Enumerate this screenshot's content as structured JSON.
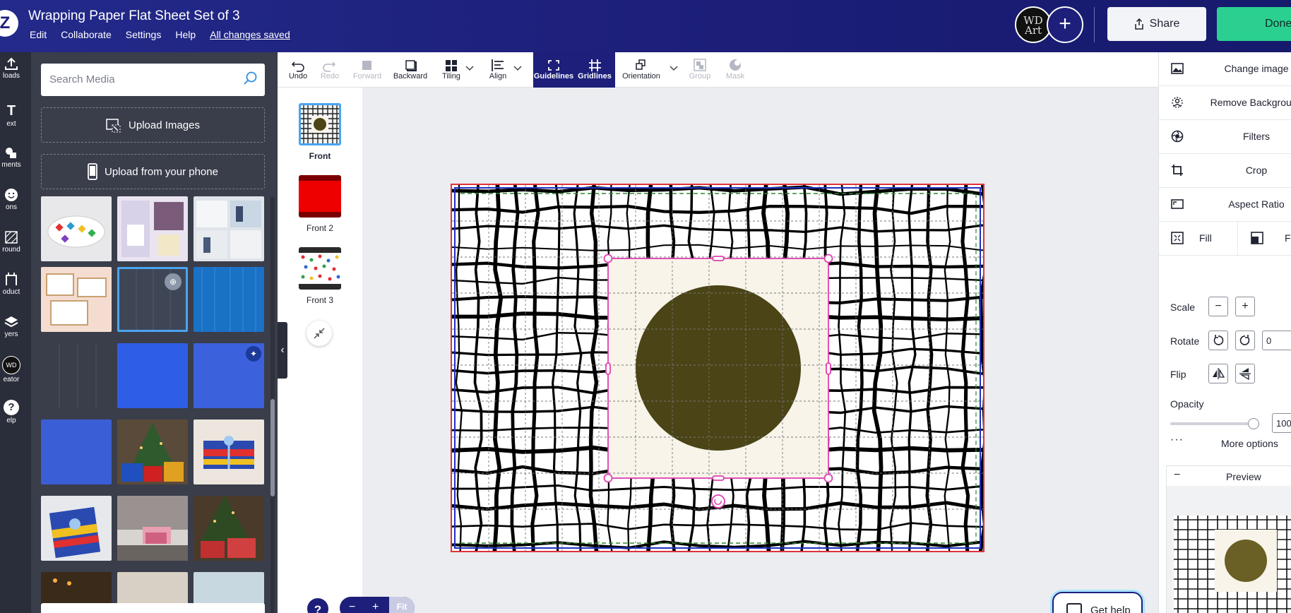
{
  "app": {
    "doc_title": "Wrapping Paper Flat Sheet Set of 3",
    "menu": [
      "Edit",
      "Collaborate",
      "Settings",
      "Help"
    ],
    "save_status": "All changes saved",
    "avatar_initials": "WD Art",
    "share_label": "Share",
    "done_label": "Done"
  },
  "rail": [
    {
      "label": "loads",
      "icon": "upload-icon"
    },
    {
      "label": "ext",
      "icon": "text-icon"
    },
    {
      "label": "ments",
      "icon": "elements-icon"
    },
    {
      "label": "ons",
      "icon": "icons-icon"
    },
    {
      "label": "round",
      "icon": "background-icon"
    },
    {
      "label": "oduct",
      "icon": "product-icon"
    },
    {
      "label": "yers",
      "icon": "layers-icon"
    },
    {
      "label": "eator",
      "icon": "creator-icon"
    },
    {
      "label": "elp",
      "icon": "help-icon"
    }
  ],
  "media": {
    "search_placeholder": "Search Media",
    "upload_images": "Upload Images",
    "upload_phone": "Upload from your phone"
  },
  "toolbar": {
    "undo": "Undo",
    "redo": "Redo",
    "forward": "Forward",
    "backward": "Backward",
    "tiling": "Tiling",
    "align": "Align",
    "guidelines": "Guidelines",
    "gridlines": "Gridlines",
    "orientation": "Orientation",
    "group": "Group",
    "mask": "Mask"
  },
  "pages": [
    {
      "label": "Front",
      "color": "#3a3a3a"
    },
    {
      "label": "Front 2",
      "color": "#ee0000"
    },
    {
      "label": "Front 3",
      "color": "#2a2a2a"
    }
  ],
  "canvas": {
    "circle_color": "#4a4416",
    "square_color": "#f8f4ea",
    "selection_color": "#e040b0"
  },
  "zoom": {
    "minus": "−",
    "plus": "+",
    "fit": "Fit"
  },
  "help_label": "?",
  "get_help": "Get help",
  "right_panel": {
    "change_image": "Change image",
    "remove_background": "Remove Background",
    "filters": "Filters",
    "crop": "Crop",
    "aspect_ratio": "Aspect Ratio",
    "fill": "Fill",
    "fit": "Fi",
    "scale": "Scale",
    "rotate": "Rotate",
    "rotate_value": "0",
    "flip": "Flip",
    "opacity": "Opacity",
    "opacity_value": "100",
    "more_options": "More options",
    "preview": "Preview"
  },
  "colors": {
    "header_bg": "#1d1f7a",
    "done_bg": "#2bd091",
    "panel_bg": "#3a3d4a",
    "rail_bg": "#2a2d3a",
    "selection": "#e040b0",
    "design_border": "#e0323a"
  }
}
